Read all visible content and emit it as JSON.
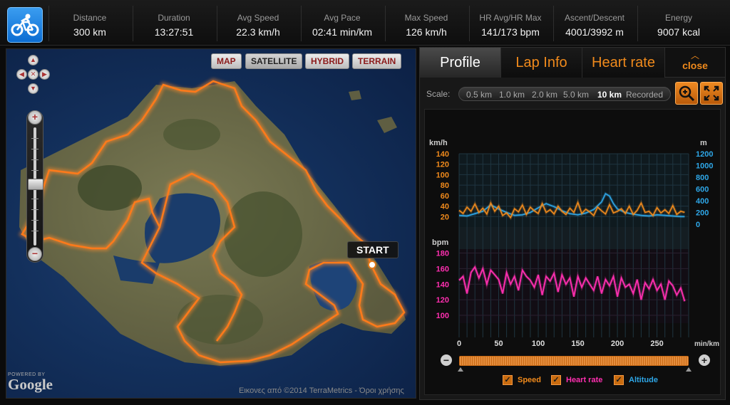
{
  "stats": [
    {
      "label": "Distance",
      "value": "300 km"
    },
    {
      "label": "Duration",
      "value": "13:27:51"
    },
    {
      "label": "Avg Speed",
      "value": "22.3 km/h"
    },
    {
      "label": "Avg Pace",
      "value": "02:41 min/km"
    },
    {
      "label": "Max Speed",
      "value": "126 km/h"
    },
    {
      "label": "HR Avg/HR Max",
      "value": "141/173 bpm"
    },
    {
      "label": "Ascent/Descent",
      "value": "4001/3992 m"
    },
    {
      "label": "Energy",
      "value": "9007 kcal"
    }
  ],
  "app_icon": "cycling-icon",
  "map": {
    "types": [
      {
        "label": "MAP",
        "active": false
      },
      {
        "label": "SATELLITE",
        "active": true
      },
      {
        "label": "HYBRID",
        "active": false
      },
      {
        "label": "TERRAIN",
        "active": false
      }
    ],
    "start_label": "START",
    "google_powered": "POWERED BY",
    "google_word": "Google",
    "credits": "Εικονες από ©2014 TerraMetrics - Όροι χρήσης",
    "zoom_in": "+",
    "zoom_out": "−",
    "route_color": "#ff7a1a"
  },
  "panel": {
    "tabs": [
      {
        "label": "Profile",
        "active": true
      },
      {
        "label": "Lap Info",
        "active": false
      },
      {
        "label": "Heart rate",
        "active": false
      }
    ],
    "close_label": "close",
    "scale_label": "Scale:",
    "scale_options": [
      {
        "label": "0.5 km",
        "active": false
      },
      {
        "label": "1.0 km",
        "active": false
      },
      {
        "label": "2.0 km",
        "active": false
      },
      {
        "label": "5.0 km",
        "active": false
      },
      {
        "label": "10 km",
        "active": true
      },
      {
        "label": "Recorded",
        "active": false
      }
    ],
    "zoom_tool_icon": "magnifier-zoom-icon",
    "fullscreen_icon": "fullscreen-icon",
    "checkboxes": [
      {
        "label": "Speed",
        "checked": true,
        "color": "#f08a1c"
      },
      {
        "label": "Heart rate",
        "checked": true,
        "color": "#ff2fb0"
      },
      {
        "label": "Altitude",
        "checked": true,
        "color": "#2ea7e8"
      }
    ],
    "check_mark": "✓",
    "slider_minus": "−",
    "slider_plus": "+"
  },
  "chart_data": {
    "type": "line",
    "top_panel": {
      "left_unit": "km/h",
      "right_unit": "m",
      "left_ticks": [
        140,
        120,
        100,
        80,
        60,
        40,
        20
      ],
      "right_ticks": [
        1200,
        1000,
        800,
        600,
        400,
        200,
        0
      ],
      "left_ylim": [
        0,
        140
      ],
      "right_ylim": [
        0,
        1200
      ],
      "series": [
        {
          "name": "Speed",
          "color": "#f08a1c",
          "axis": "left",
          "x": [
            0,
            5,
            10,
            15,
            20,
            25,
            30,
            35,
            40,
            45,
            50,
            55,
            60,
            65,
            70,
            75,
            80,
            85,
            90,
            95,
            100,
            105,
            110,
            115,
            120,
            125,
            130,
            135,
            140,
            145,
            150,
            155,
            160,
            165,
            170,
            175,
            180,
            185,
            190,
            195,
            200,
            205,
            210,
            215,
            220,
            225,
            230,
            235,
            240,
            245,
            250,
            255,
            260,
            265,
            270,
            275,
            280,
            285
          ],
          "values": [
            32,
            26,
            38,
            30,
            44,
            28,
            36,
            25,
            46,
            30,
            40,
            22,
            27,
            18,
            35,
            29,
            42,
            24,
            38,
            31,
            26,
            45,
            28,
            33,
            25,
            40,
            30,
            24,
            36,
            28,
            47,
            26,
            34,
            29,
            22,
            38,
            31,
            25,
            43,
            27,
            30,
            35,
            26,
            40,
            24,
            32,
            46,
            28,
            30,
            22,
            37,
            27,
            33,
            26,
            41,
            24,
            30,
            28
          ]
        },
        {
          "name": "Altitude",
          "color": "#2ea7e8",
          "axis": "right",
          "x": [
            0,
            10,
            20,
            30,
            40,
            50,
            60,
            70,
            80,
            90,
            100,
            110,
            120,
            130,
            140,
            150,
            160,
            170,
            180,
            185,
            190,
            195,
            200,
            210,
            220,
            230,
            240,
            250,
            260,
            270,
            280,
            285
          ],
          "values": [
            150,
            140,
            180,
            220,
            330,
            260,
            200,
            150,
            160,
            200,
            280,
            350,
            300,
            230,
            180,
            160,
            190,
            250,
            380,
            520,
            480,
            350,
            260,
            200,
            170,
            150,
            140,
            160,
            150,
            140,
            130,
            130
          ]
        }
      ]
    },
    "bottom_panel": {
      "unit": "bpm",
      "ticks": [
        180,
        160,
        140,
        120,
        100
      ],
      "ylim": [
        90,
        185
      ],
      "series": [
        {
          "name": "Heart rate",
          "color": "#ff2fb0",
          "x": [
            0,
            5,
            10,
            15,
            20,
            25,
            30,
            35,
            40,
            45,
            50,
            55,
            60,
            65,
            70,
            75,
            80,
            85,
            90,
            95,
            100,
            105,
            110,
            115,
            120,
            125,
            130,
            135,
            140,
            145,
            150,
            155,
            160,
            165,
            170,
            175,
            180,
            185,
            190,
            195,
            200,
            205,
            210,
            215,
            220,
            225,
            230,
            235,
            240,
            245,
            250,
            255,
            260,
            265,
            270,
            275,
            280,
            285
          ],
          "values": [
            145,
            150,
            128,
            155,
            162,
            148,
            160,
            140,
            158,
            152,
            146,
            128,
            155,
            140,
            150,
            132,
            158,
            150,
            145,
            136,
            152,
            126,
            150,
            144,
            154,
            130,
            152,
            140,
            148,
            124,
            150,
            136,
            148,
            140,
            132,
            150,
            128,
            146,
            138,
            150,
            124,
            148,
            136,
            140,
            128,
            146,
            120,
            142,
            134,
            146,
            132,
            140,
            120,
            144,
            138,
            126,
            135,
            118
          ]
        }
      ]
    },
    "x_ticks": [
      0,
      50,
      100,
      150,
      200,
      250
    ],
    "x_unit": "min/km",
    "xlim": [
      0,
      290
    ],
    "grid": true
  }
}
